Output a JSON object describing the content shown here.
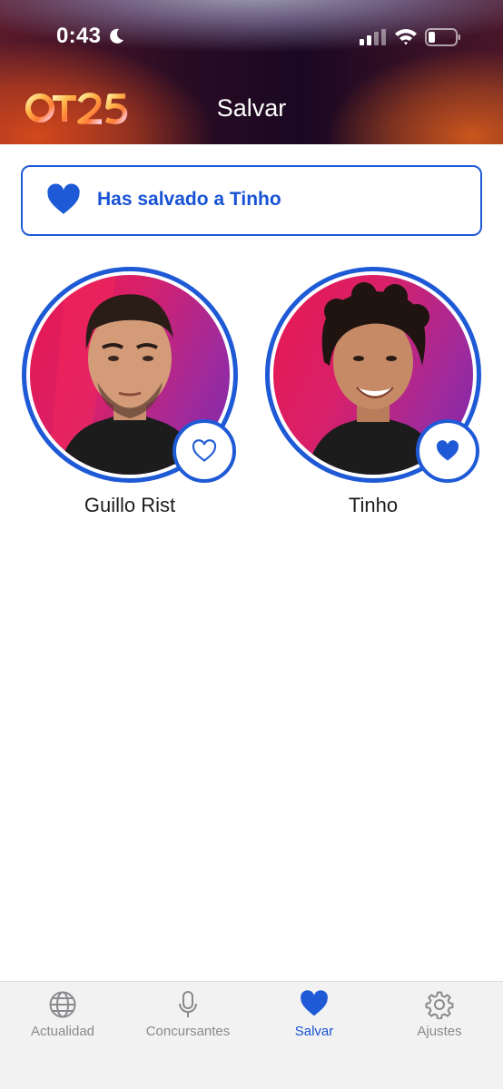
{
  "status_bar": {
    "time": "0:43",
    "icons": [
      "moon-icon",
      "signal-icon",
      "wifi-icon",
      "battery-icon"
    ]
  },
  "header": {
    "logo": "OT25",
    "title": "Salvar"
  },
  "banner": {
    "icon": "heart-filled-icon",
    "text": "Has salvado a Tinho"
  },
  "contestants": [
    {
      "name": "Guillo Rist",
      "saved": false,
      "icon": "heart-outline-icon"
    },
    {
      "name": "Tinho",
      "saved": true,
      "icon": "heart-filled-icon"
    }
  ],
  "tabbar": {
    "items": [
      {
        "label": "Actualidad",
        "icon": "globe-icon",
        "active": false
      },
      {
        "label": "Concursantes",
        "icon": "microphone-icon",
        "active": false
      },
      {
        "label": "Salvar",
        "icon": "heart-icon",
        "active": true
      },
      {
        "label": "Ajustes",
        "icon": "gear-icon",
        "active": false
      }
    ]
  },
  "colors": {
    "accent": "#1f5ad6",
    "accent_text": "#1753d4",
    "tab_inactive": "#8a8a8e",
    "tabbar_bg": "#f2f2f2"
  }
}
